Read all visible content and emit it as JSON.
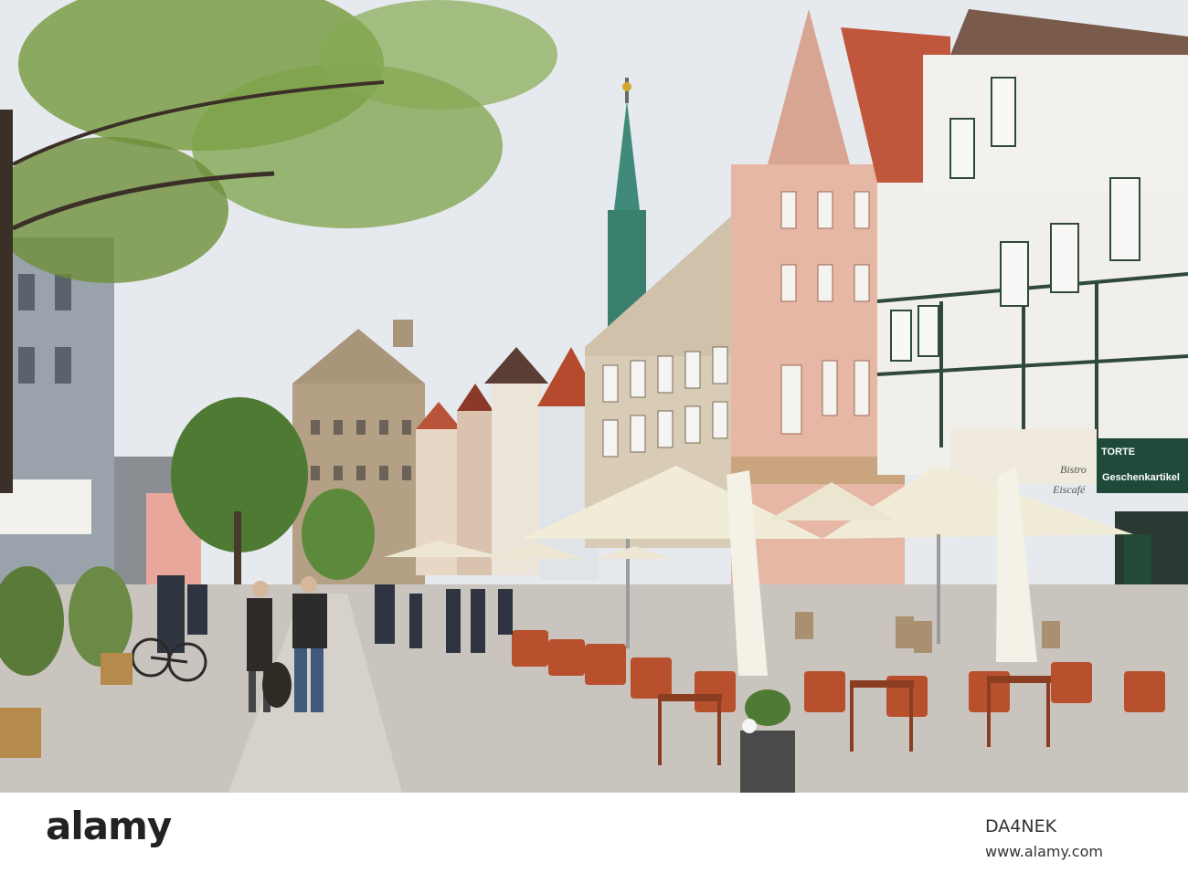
{
  "watermark": {
    "brand": "alamy",
    "image_id": "DA4NEK",
    "website": "www.alamy.com"
  },
  "scene_signs": {
    "shop_sign": "Geschenkartikel",
    "shop_sign_top": "TORTE",
    "awning_text_1": "Bistro",
    "awning_text_2": "Eiscafé"
  },
  "colors": {
    "sky": "#e6e9ee",
    "tree": "#6f8f3a",
    "spire": "#3f8a78",
    "pink_facade": "#e6b7a5",
    "sandstone": "#b8a58a",
    "umbrella": "#f1ecd7",
    "pavement": "#c9c4bd",
    "chair": "#b8502e"
  }
}
